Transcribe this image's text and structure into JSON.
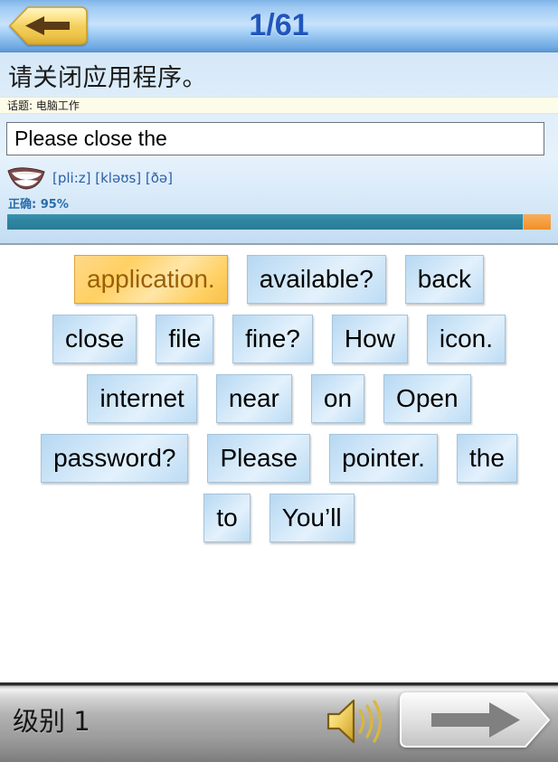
{
  "header": {
    "progress_counter": "1/61",
    "back_button_label": "Back",
    "back_icon": "arrow-left-icon"
  },
  "question": {
    "prompt_chinese": "请关闭应用程序。",
    "topic_label": "话题: 电脑工作",
    "answer_value": "Please close the",
    "answer_placeholder": "",
    "pronunciation_icon": "mouth-icon",
    "ipa": "[pli:z] [kləʊs] [ðə]",
    "accuracy_label": "正确: 95%",
    "accuracy_percent": 95
  },
  "word_bank": {
    "rows": [
      [
        {
          "label": "application.",
          "selected": true
        },
        {
          "label": "available?",
          "selected": false
        },
        {
          "label": "back",
          "selected": false
        }
      ],
      [
        {
          "label": "close",
          "selected": false
        },
        {
          "label": "file",
          "selected": false
        },
        {
          "label": "fine?",
          "selected": false
        },
        {
          "label": "How",
          "selected": false
        },
        {
          "label": "icon.",
          "selected": false
        }
      ],
      [
        {
          "label": "internet",
          "selected": false
        },
        {
          "label": "near",
          "selected": false
        },
        {
          "label": "on",
          "selected": false
        },
        {
          "label": "Open",
          "selected": false
        }
      ],
      [
        {
          "label": "password?",
          "selected": false
        },
        {
          "label": "Please",
          "selected": false
        },
        {
          "label": "pointer.",
          "selected": false
        },
        {
          "label": "the",
          "selected": false
        }
      ],
      [
        {
          "label": "to",
          "selected": false
        },
        {
          "label": "You’ll",
          "selected": false
        }
      ]
    ]
  },
  "footer": {
    "level_text": "级别 1",
    "speaker_icon": "speaker-icon",
    "next_icon": "arrow-right-icon"
  },
  "colors": {
    "header_blue": "#9fcaf3",
    "title_blue": "#2255bb",
    "gold": "#ffd063",
    "selected_text": "#9a5f06",
    "progress_teal": "#2f86a1",
    "progress_orange": "#f59c3c",
    "topic_cream": "#fdfce8",
    "tile_blue": "#cfe6f8",
    "footer_silver": "#b3b3b3"
  }
}
